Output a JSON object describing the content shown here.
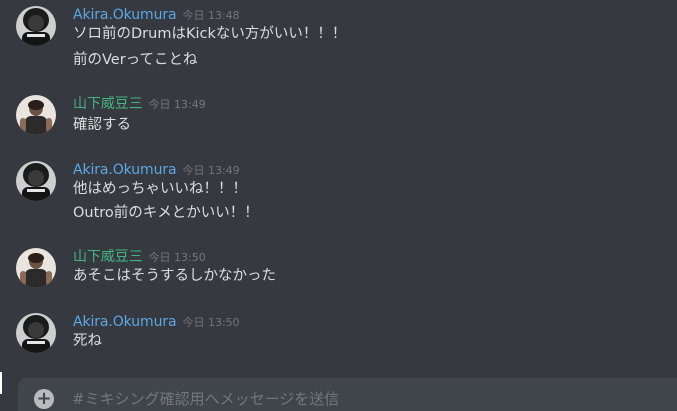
{
  "colors": {
    "background": "#36393f",
    "user_blue": "#5ba8e6",
    "user_green": "#43b581",
    "message_text": "#dcddde",
    "timestamp": "#72767d",
    "composer_bg": "#40444b"
  },
  "messages": [
    {
      "username": "Akira.Okumura",
      "timestamp": "今日 13:48",
      "lines": [
        "ソロ前のDrumはKickない方がいい！！！",
        "前のVerってことね"
      ]
    },
    {
      "username": "山下威豆三",
      "timestamp": "今日 13:49",
      "lines": [
        "確認する"
      ]
    },
    {
      "username": "Akira.Okumura",
      "timestamp": "今日 13:49",
      "lines": [
        "他はめっちゃいいね！！！",
        "Outro前のキメとかいい！！"
      ]
    },
    {
      "username": "山下威豆三",
      "timestamp": "今日 13:50",
      "lines": [
        "あそこはそうするしかなかった"
      ]
    },
    {
      "username": "Akira.Okumura",
      "timestamp": "今日 13:50",
      "lines": [
        "死ね"
      ]
    }
  ],
  "composer": {
    "placeholder": "#ミキシング確認用へメッセージを送信",
    "plus_icon": "+"
  }
}
